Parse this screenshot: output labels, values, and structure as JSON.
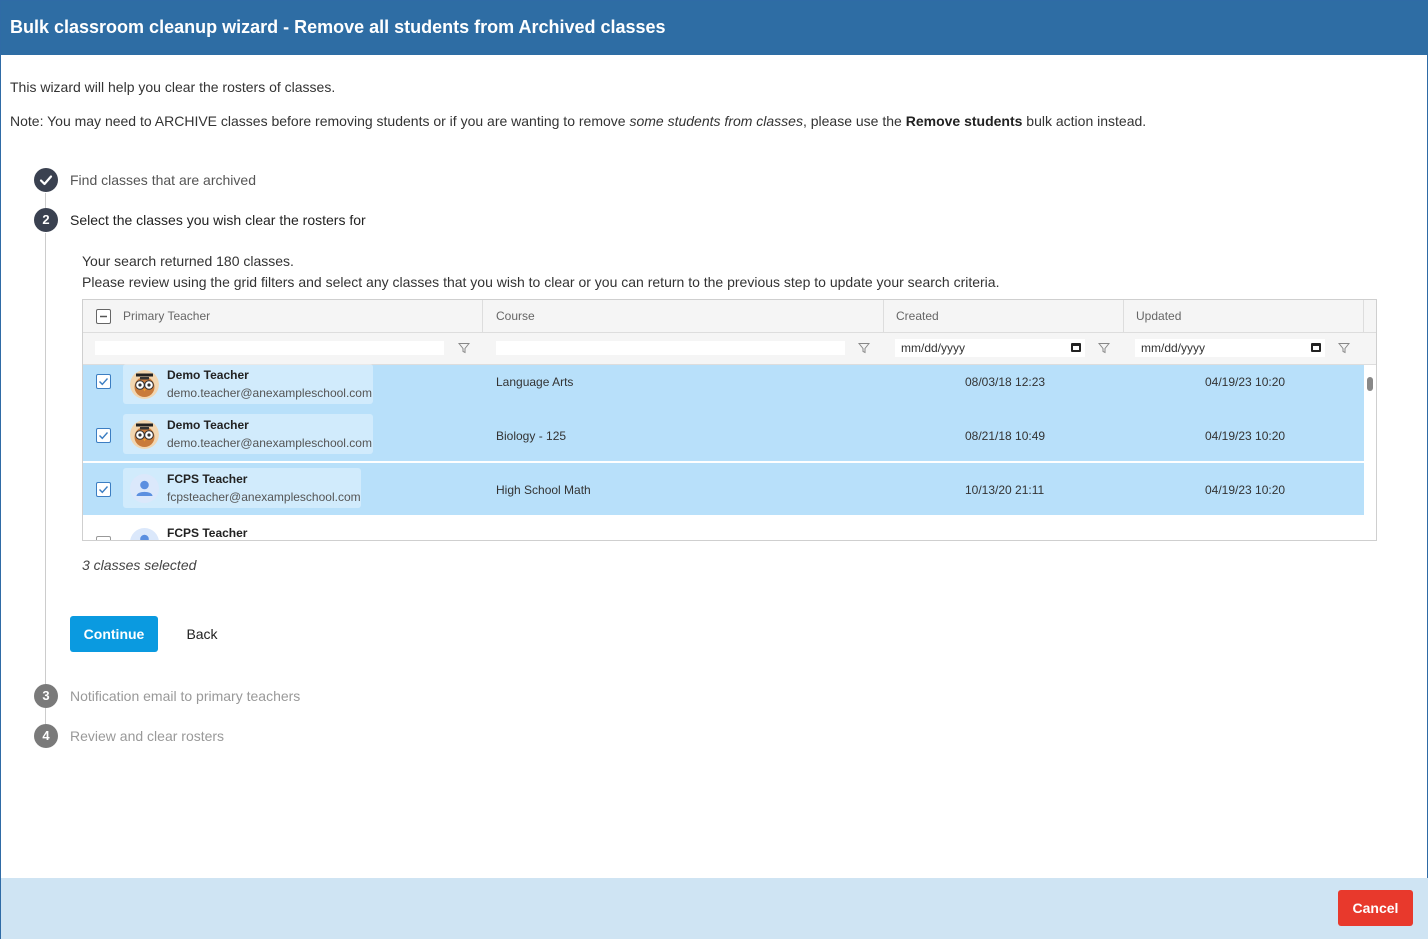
{
  "window": {
    "title": "Bulk classroom cleanup wizard - Remove all students from Archived classes"
  },
  "intro": {
    "line1": "This wizard will help you clear the rosters of classes.",
    "note_a": "Note: You may need to ARCHIVE classes before removing students or if you are wanting to remove ",
    "note_b": "some students from classes",
    "note_c": ", please use the ",
    "note_d": "Remove students",
    "note_e": " bulk action instead."
  },
  "steps": [
    {
      "number": "",
      "label": "Find classes that are archived",
      "state": "done"
    },
    {
      "number": "2",
      "label": "Select the classes you wish clear the rosters for",
      "state": "active"
    },
    {
      "number": "3",
      "label": "Notification email to primary teachers",
      "state": "pending"
    },
    {
      "number": "4",
      "label": "Review and clear rosters",
      "state": "pending"
    }
  ],
  "search": {
    "result_text": "Your search returned 180 classes.",
    "review_text": "Please review using the grid filters and select any classes that you wish to clear or you can return to the previous step to update your search criteria."
  },
  "grid": {
    "columns": [
      "Primary Teacher",
      "Course",
      "Created",
      "Updated"
    ],
    "filters": {
      "created_placeholder": "mm/dd/yyyy",
      "updated_placeholder": "mm/dd/yyyy"
    },
    "rows": [
      {
        "teacher": "Demo Teacher",
        "email": "demo.teacher@anexampleschool.com",
        "avatar": "owl-avatar-icon",
        "course": "Language Arts",
        "created": "08/03/18 12:23",
        "updated": "04/19/23 10:20",
        "selected": true
      },
      {
        "teacher": "Demo Teacher",
        "email": "demo.teacher@anexampleschool.com",
        "avatar": "owl-avatar-icon",
        "course": "Biology - 125",
        "created": "08/21/18 10:49",
        "updated": "04/19/23 10:20",
        "selected": true
      },
      {
        "teacher": "FCPS Teacher",
        "email": "fcpsteacher@anexampleschool.com",
        "avatar": "person-avatar-icon",
        "course": "High School Math",
        "created": "10/13/20 21:11",
        "updated": "04/19/23 10:20",
        "selected": true
      },
      {
        "teacher": "FCPS Teacher",
        "email": "",
        "avatar": "person-avatar-icon",
        "course": "",
        "created": "",
        "updated": "",
        "selected": false
      }
    ]
  },
  "selection": {
    "count_text": "3 classes selected"
  },
  "buttons": {
    "continue": "Continue",
    "back": "Back",
    "cancel": "Cancel"
  },
  "colors": {
    "header": "#2e6da4",
    "selected_row": "#b8e0fa",
    "primary": "#0a9ae0",
    "danger": "#e8392c",
    "footer": "#cfe4f3",
    "step_done": "#3a4150"
  }
}
